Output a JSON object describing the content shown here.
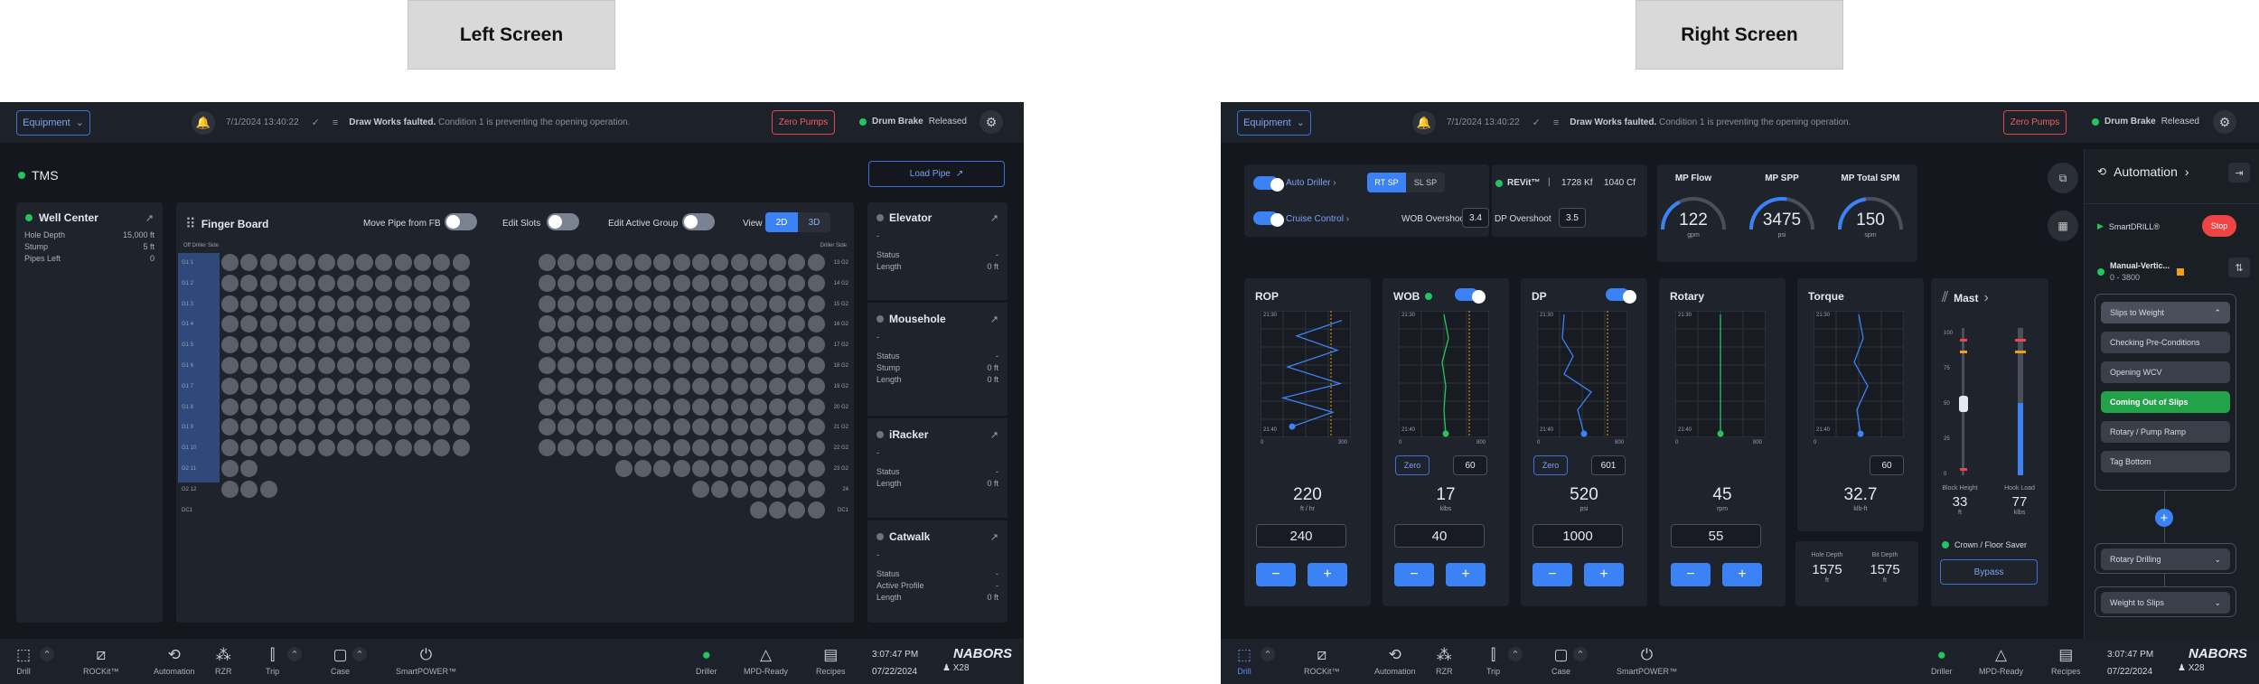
{
  "labels": {
    "left": "Left Screen",
    "right": "Right Screen"
  },
  "header": {
    "equipment": "Equipment",
    "timestamp": "7/1/2024 13:40:22",
    "msg_bold": "Draw Works faulted.",
    "msg_rest": " Condition 1 is preventing the opening operation.",
    "zero_pumps": "Zero Pumps",
    "drum_brake": "Drum Brake",
    "drum_state": "Released"
  },
  "bottom": {
    "items": [
      {
        "label": "Drill",
        "icon": "drill-icon"
      },
      {
        "label": "ROCKit™",
        "icon": "rockit-icon"
      },
      {
        "label": "Automation",
        "icon": "automation-icon"
      },
      {
        "label": "RZR",
        "icon": "rzr-icon"
      },
      {
        "label": "Trip",
        "icon": "trip-icon"
      },
      {
        "label": "Case",
        "icon": "case-icon"
      },
      {
        "label": "SmartPOWER™",
        "icon": "power-icon"
      }
    ],
    "driller": "Driller",
    "mpd": "MPD-Ready",
    "recipes": "Recipes",
    "time": "3:07:47 PM",
    "date": "07/22/2024",
    "brand": "NABORS",
    "rig": "X28"
  },
  "left": {
    "tms": "TMS",
    "load_pipe": "Load Pipe",
    "well": {
      "title": "Well Center",
      "rows": [
        {
          "k": "Hole Depth",
          "v": "15,000 ft"
        },
        {
          "k": "Stump",
          "v": "5 ft"
        },
        {
          "k": "Pipes Left",
          "v": "0"
        }
      ]
    },
    "fb": {
      "title": "Finger Board",
      "move": "Move Pipe from FB",
      "edit_slots": "Edit Slots",
      "edit_group": "Edit Active Group",
      "view": "View",
      "v2d": "2D",
      "v3d": "3D",
      "off_side": "Off Driller Side",
      "drl_side": "Driller Side",
      "rows": [
        {
          "l": "G1 1",
          "r": "13 G2"
        },
        {
          "l": "G1 2",
          "r": "14 G2"
        },
        {
          "l": "G1 3",
          "r": "15 G2"
        },
        {
          "l": "G1 4",
          "r": "16 G2"
        },
        {
          "l": "G1 5",
          "r": "17 G2"
        },
        {
          "l": "G1 6",
          "r": "18 G2"
        },
        {
          "l": "G1 7",
          "r": "19 G2"
        },
        {
          "l": "G1 8",
          "r": "20 G2"
        },
        {
          "l": "G1 9",
          "r": "21 G2"
        },
        {
          "l": "G1 10",
          "r": "22 G2"
        },
        {
          "l": "G2 11",
          "r": "23 G2"
        },
        {
          "l": "G2 12",
          "r": "24"
        },
        {
          "l": "DC1",
          "r": "DC1"
        }
      ]
    },
    "equip": [
      {
        "title": "Elevator",
        "sub": "-",
        "rows": [
          {
            "k": "Status",
            "v": "-"
          },
          {
            "k": "Length",
            "v": "0 ft"
          }
        ]
      },
      {
        "title": "Mousehole",
        "sub": "-",
        "rows": [
          {
            "k": "Status",
            "v": "-"
          },
          {
            "k": "Stump",
            "v": "0 ft"
          },
          {
            "k": "Length",
            "v": "0 ft"
          }
        ]
      },
      {
        "title": "iRacker",
        "sub": "-",
        "rows": [
          {
            "k": "Status",
            "v": "-"
          },
          {
            "k": "Length",
            "v": "0 ft"
          }
        ]
      },
      {
        "title": "Catwalk",
        "sub": "-",
        "rows": [
          {
            "k": "Status",
            "v": "-"
          },
          {
            "k": "Active Profile",
            "v": "-"
          },
          {
            "k": "Length",
            "v": "0 ft"
          }
        ]
      }
    ]
  },
  "right": {
    "auto_driller": "Auto Driller",
    "rt_sp": "RT SP",
    "sl_sp": "SL SP",
    "revit": "REVit™",
    "revit_v1": "1728 Kf",
    "revit_v2": "1040 Cf",
    "cruise": "Cruise Control",
    "wob_over": "WOB Overshoot",
    "wob_over_v": "3.4",
    "dp_over": "DP Overshoot",
    "dp_over_v": "3.5",
    "gauges": [
      {
        "title": "MP Flow",
        "value": "122",
        "unit": "gpm",
        "frac": 0.35
      },
      {
        "title": "MP SPP",
        "value": "3475",
        "unit": "psi",
        "frac": 0.55
      },
      {
        "title": "MP Total SPM",
        "value": "150",
        "unit": "spm",
        "frac": 0.45
      }
    ],
    "cards": [
      {
        "title": "ROP",
        "value": "220",
        "unit": "ft / hr",
        "setpoint": "240",
        "xmax": "300",
        "y1": "21:30",
        "y2": "21:40"
      },
      {
        "title": "WOB",
        "value": "17",
        "unit": "klbs",
        "setpoint": "40",
        "zero": "Zero",
        "limit": "60",
        "xmax": "800",
        "y1": "21:30",
        "y2": "21:40"
      },
      {
        "title": "DP",
        "value": "520",
        "unit": "psi",
        "setpoint": "1000",
        "zero": "Zero",
        "limit": "601",
        "xmax": "800",
        "y1": "21:30",
        "y2": "21:40"
      },
      {
        "title": "Rotary",
        "value": "45",
        "unit": "rpm",
        "setpoint": "55",
        "xmax": "800",
        "y1": "21:30",
        "y2": "21:40"
      },
      {
        "title": "Torque",
        "value": "32.7",
        "unit": "klb-ft",
        "limit": "60",
        "xmax": "",
        "y1": "21:30",
        "y2": "21:40"
      }
    ],
    "hole_depth": "Hole Depth",
    "hole_depth_v": "1575",
    "bit_depth": "Bit Depth",
    "bit_depth_v": "1575",
    "ft": "ft",
    "mast": {
      "title": "Mast",
      "block": "Block Height",
      "block_v": "33",
      "block_u": "ft",
      "hook": "Hook Load",
      "hook_v": "77",
      "hook_u": "klbs",
      "crown": "Crown / Floor Saver",
      "bypass": "Bypass",
      "ticks": [
        "100",
        "75",
        "50",
        "25",
        "0"
      ]
    },
    "auto": {
      "title": "Automation",
      "smartdrill": "SmartDRILL®",
      "stop": "Stop",
      "manual": "Manual-Vertic...",
      "range": "0 - 3800",
      "seq_title": "Slips to Weight",
      "seq": [
        "Checking Pre-Conditions",
        "Opening WCV",
        "Coming Out of Slips",
        "Rotary / Pump Ramp",
        "Tag Bottom"
      ],
      "rotary": "Rotary Drilling",
      "w2s": "Weight to Slips"
    }
  }
}
